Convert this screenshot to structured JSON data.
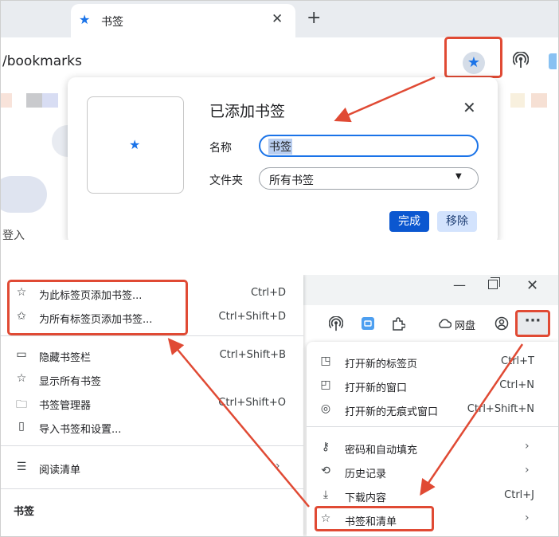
{
  "top": {
    "tab_title": "书签",
    "url": "/bookmarks",
    "side_text": "登入"
  },
  "dialog": {
    "title": "已添加书签",
    "name_label": "名称",
    "name_value": "书签",
    "folder_label": "文件夹",
    "folder_value": "所有书签",
    "done_label": "完成",
    "remove_label": "移除"
  },
  "bookmark_menu": {
    "items": [
      {
        "icon": "star-icon",
        "label": "为此标签页添加书签...",
        "shortcut": "Ctrl+D"
      },
      {
        "icon": "stars-icon",
        "label": "为所有标签页添加书签...",
        "shortcut": "Ctrl+Shift+D"
      },
      {
        "icon": "bookmark-bar-icon",
        "label": "隐藏书签栏",
        "shortcut": "Ctrl+Shift+B"
      },
      {
        "icon": "star-outline-icon",
        "label": "显示所有书签",
        "shortcut": ""
      },
      {
        "icon": "folder-icon",
        "label": "书签管理器",
        "shortcut": "Ctrl+Shift+O"
      },
      {
        "icon": "book-icon",
        "label": "导入书签和设置...",
        "shortcut": ""
      },
      {
        "icon": "reading-list-icon",
        "label": "阅读清单",
        "shortcut": ""
      }
    ],
    "section_label": "书签"
  },
  "main_menu": {
    "netdisk_label": "网盘",
    "items": [
      {
        "icon": "new-tab-icon",
        "label": "打开新的标签页",
        "shortcut": "Ctrl+T"
      },
      {
        "icon": "new-window-icon",
        "label": "打开新的窗口",
        "shortcut": "Ctrl+N"
      },
      {
        "icon": "incognito-icon",
        "label": "打开新的无痕式窗口",
        "shortcut": "Ctrl+Shift+N"
      },
      {
        "icon": "key-icon",
        "label": "密码和自动填充",
        "shortcut": ""
      },
      {
        "icon": "history-icon",
        "label": "历史记录",
        "shortcut": ""
      },
      {
        "icon": "download-icon",
        "label": "下载内容",
        "shortcut": "Ctrl+J"
      },
      {
        "icon": "star-outline-icon",
        "label": "书签和清单",
        "shortcut": ""
      }
    ]
  },
  "colors": {
    "annotation_red": "#e04a34",
    "accent_blue": "#1a73e8"
  }
}
